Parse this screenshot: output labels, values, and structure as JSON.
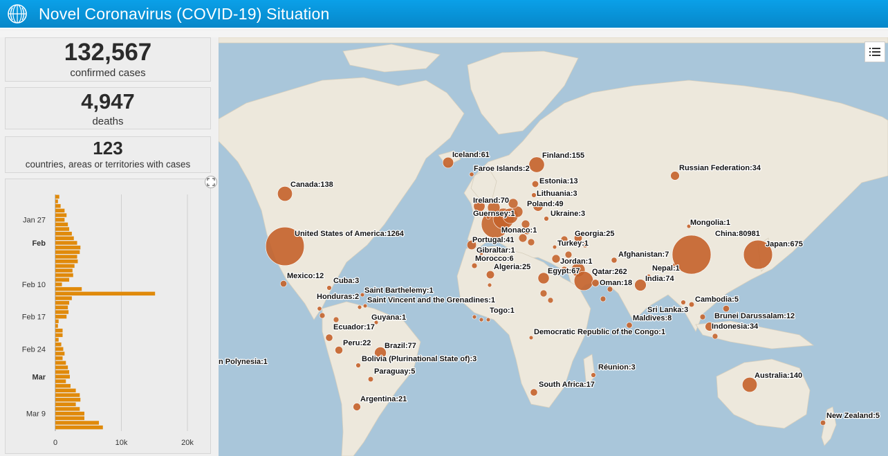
{
  "header": {
    "title": "Novel Coronavirus (COVID-19) Situation",
    "logo_icon": "who-emblem-icon",
    "color": "#0a95db"
  },
  "stats": {
    "confirmed": {
      "value": "132,567",
      "label": "confirmed cases"
    },
    "deaths": {
      "value": "4,947",
      "label": "deaths"
    },
    "countries": {
      "value": "123",
      "label": "countries, areas or territories with cases"
    }
  },
  "chart_data": {
    "type": "bar",
    "orientation": "horizontal",
    "bar_color": "#e08a0b",
    "y_ticks": [
      "Jan 27",
      "Feb",
      "Feb 10",
      "Feb 17",
      "Feb 24",
      "Mar",
      "Mar 9"
    ],
    "bold_ticks": [
      "Feb",
      "Mar"
    ],
    "x_ticks": [
      "0",
      "10k",
      "20k"
    ],
    "xlim": [
      0,
      20000
    ],
    "categories": [
      "Jan 22",
      "Jan 23",
      "Jan 24",
      "Jan 25",
      "Jan 26",
      "Jan 27",
      "Jan 28",
      "Jan 29",
      "Jan 30",
      "Jan 31",
      "Feb 1",
      "Feb 2",
      "Feb 3",
      "Feb 4",
      "Feb 5",
      "Feb 6",
      "Feb 7",
      "Feb 8",
      "Feb 9",
      "Feb 10",
      "Feb 11",
      "Feb 12",
      "Feb 13",
      "Feb 14",
      "Feb 15",
      "Feb 16",
      "Feb 17",
      "Feb 18",
      "Feb 19",
      "Feb 20",
      "Feb 21",
      "Feb 22",
      "Feb 23",
      "Feb 24",
      "Feb 25",
      "Feb 26",
      "Feb 27",
      "Feb 28",
      "Feb 29",
      "Mar 1",
      "Mar 2",
      "Mar 3",
      "Mar 4",
      "Mar 5",
      "Mar 6",
      "Mar 7",
      "Mar 8",
      "Mar 9",
      "Mar 10",
      "Mar 11",
      "Mar 12"
    ],
    "values": [
      600,
      400,
      800,
      1400,
      1700,
      1400,
      1900,
      2100,
      2500,
      2800,
      3300,
      3800,
      3700,
      3300,
      3400,
      2900,
      2600,
      2700,
      2100,
      1000,
      4000,
      15100,
      2500,
      2100,
      1900,
      2000,
      1700,
      500,
      400,
      1100,
      1100,
      500,
      900,
      1200,
      1400,
      1100,
      1600,
      1900,
      2100,
      2200,
      1600,
      2300,
      3100,
      3700,
      3800,
      3100,
      3700,
      4400,
      4400,
      6600,
      7200
    ]
  },
  "map": {
    "ocean_color": "#a9c6da",
    "land_color": "#ede8dc",
    "bubble_color": "#c4622a",
    "legend_icon": "legend-list-icon",
    "markers": [
      {
        "label": "Iceland:61",
        "cases": 61
      },
      {
        "label": "Faroe Islands:2",
        "cases": 2
      },
      {
        "label": "Finland:155",
        "cases": 155
      },
      {
        "label": "Estonia:13",
        "cases": 13
      },
      {
        "label": "Lithuania:3",
        "cases": 3
      },
      {
        "label": "Poland:49",
        "cases": 49
      },
      {
        "label": "Ukraine:3",
        "cases": 3
      },
      {
        "label": "Ireland:70",
        "cases": 70
      },
      {
        "label": "Guernsey:1",
        "cases": 1
      },
      {
        "label": "Monaco:1",
        "cases": 1
      },
      {
        "label": "Portugal:41",
        "cases": 41
      },
      {
        "label": "Gibraltar:1",
        "cases": 1
      },
      {
        "label": "Morocco:6",
        "cases": 6
      },
      {
        "label": "Algeria:25",
        "cases": 25
      },
      {
        "label": "Georgia:25",
        "cases": 25
      },
      {
        "label": "Turkey:1",
        "cases": 1
      },
      {
        "label": "Jordan:1",
        "cases": 1
      },
      {
        "label": "Egypt:67",
        "cases": 67
      },
      {
        "label": "Qatar:262",
        "cases": 262
      },
      {
        "label": "Oman:18",
        "cases": 18
      },
      {
        "label": "Afghanistan:7",
        "cases": 7
      },
      {
        "label": "Nepal:1",
        "cases": 1
      },
      {
        "label": "India:74",
        "cases": 74
      },
      {
        "label": "Mongolia:1",
        "cases": 1
      },
      {
        "label": "China:80981",
        "cases": 80981
      },
      {
        "label": "Japan:675",
        "cases": 675
      },
      {
        "label": "Russian Federation:34",
        "cases": 34
      },
      {
        "label": "Sri Lanka:3",
        "cases": 3
      },
      {
        "label": "Cambodia:5",
        "cases": 5
      },
      {
        "label": "Maldives:8",
        "cases": 8
      },
      {
        "label": "Brunei Darussalam:12",
        "cases": 12
      },
      {
        "label": "Indonesia:34",
        "cases": 34
      },
      {
        "label": "Canada:138",
        "cases": 138
      },
      {
        "label": "United States of America:1264",
        "cases": 1264
      },
      {
        "label": "Mexico:12",
        "cases": 12
      },
      {
        "label": "Cuba:3",
        "cases": 3
      },
      {
        "label": "Saint Barthelemy:1",
        "cases": 1
      },
      {
        "label": "Honduras:2",
        "cases": 2
      },
      {
        "label": "Saint Vincent and the Grenadines:1",
        "cases": 1
      },
      {
        "label": "Togo:1",
        "cases": 1
      },
      {
        "label": "Guyana:1",
        "cases": 1
      },
      {
        "label": "Ecuador:17",
        "cases": 17
      },
      {
        "label": "Democratic Republic of the Congo:1",
        "cases": 1
      },
      {
        "label": "Peru:22",
        "cases": 22
      },
      {
        "label": "Brazil:77",
        "cases": 77
      },
      {
        "label": "Bolivia (Plurinational State of):3",
        "cases": 3
      },
      {
        "label": "n Polynesia:1",
        "cases": 1
      },
      {
        "label": "Paraguay:5",
        "cases": 5
      },
      {
        "label": "Argentina:21",
        "cases": 21
      },
      {
        "label": "Réunion:3",
        "cases": 3
      },
      {
        "label": "South Africa:17",
        "cases": 17
      },
      {
        "label": "Australia:140",
        "cases": 140
      },
      {
        "label": "New Zealand:5",
        "cases": 5
      }
    ]
  }
}
